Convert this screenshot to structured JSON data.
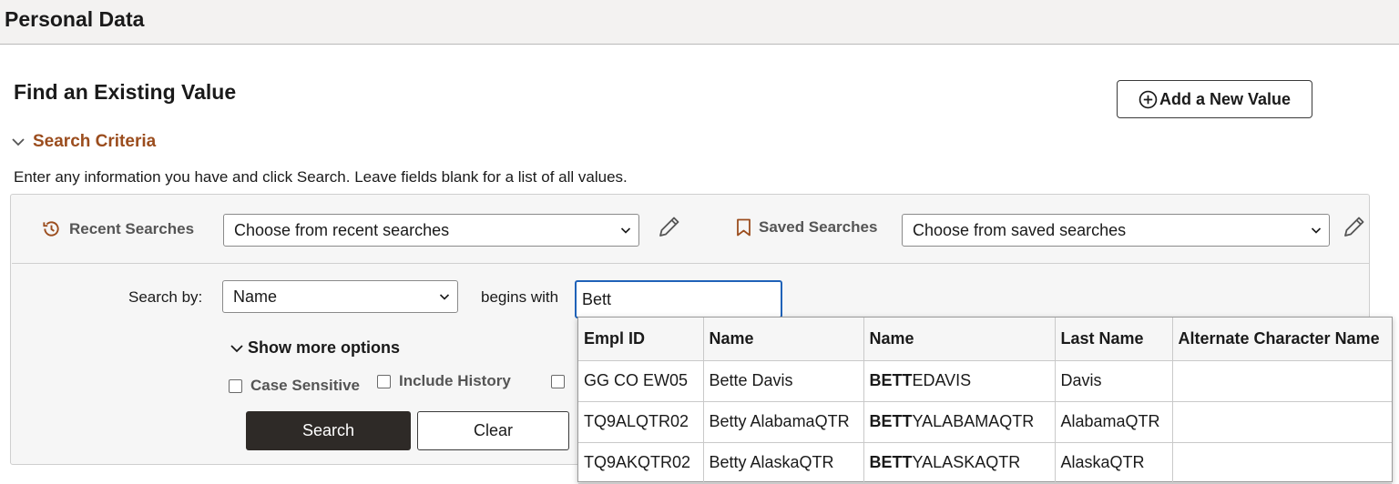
{
  "header": {
    "title": "Personal Data"
  },
  "page": {
    "heading": "Find an Existing Value",
    "add_button_label": "Add a New Value",
    "criteria_label": "Search Criteria",
    "instructions": "Enter any information you have and click Search. Leave fields blank for a list of all values."
  },
  "recent": {
    "label": "Recent Searches",
    "selected": "Choose from recent searches"
  },
  "saved": {
    "label": "Saved Searches",
    "selected": "Choose from saved searches"
  },
  "search": {
    "by_label": "Search by:",
    "by_value": "Name",
    "operator": "begins with",
    "input_value": "Bett",
    "more_options": "Show more options",
    "case_sensitive": "Case Sensitive",
    "include_history": "Include History",
    "search_button": "Search",
    "clear_button": "Clear"
  },
  "suggestions": {
    "headers": [
      "Empl ID",
      "Name",
      "Name",
      "Last Name",
      "Alternate Character Name"
    ],
    "rows": [
      {
        "emplid": "GG CO EW05",
        "name": "Bette Davis",
        "name_match": "BETT",
        "name_rest": "EDAVIS",
        "last_name": "Davis",
        "alt_name": ""
      },
      {
        "emplid": "TQ9ALQTR02",
        "name": "Betty AlabamaQTR",
        "name_match": "BETT",
        "name_rest": "YALABAMAQTR",
        "last_name": "AlabamaQTR",
        "alt_name": ""
      },
      {
        "emplid": "TQ9AKQTR02",
        "name": "Betty AlaskaQTR",
        "name_match": "BETT",
        "name_rest": "YALASKAQTR",
        "last_name": "AlaskaQTR",
        "alt_name": ""
      }
    ]
  },
  "colors": {
    "accent": "#9b4d1e",
    "focus": "#1f62b8",
    "primary_button": "#2e2a27"
  }
}
